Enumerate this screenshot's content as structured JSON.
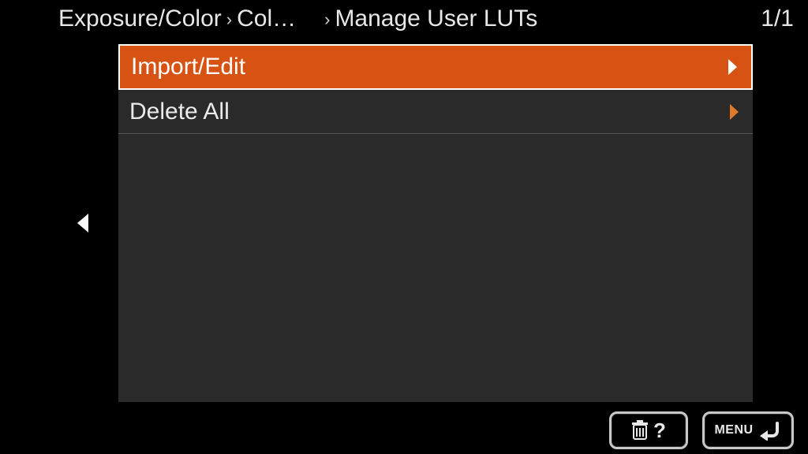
{
  "breadcrumb": {
    "segments": [
      "Exposure/Color",
      "Col…",
      "Manage User LUTs"
    ]
  },
  "page_indicator": "1/1",
  "menu": {
    "items": [
      {
        "label": "Import/Edit",
        "selected": true
      },
      {
        "label": "Delete All",
        "selected": false
      }
    ]
  },
  "footer": {
    "help_symbol": "?",
    "menu_label": "MENU"
  }
}
